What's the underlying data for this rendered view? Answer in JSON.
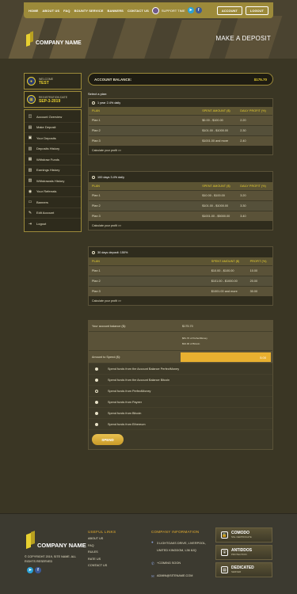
{
  "header": {
    "nav": [
      "HOME",
      "ABOUT US",
      "FAQ",
      "BOUNTY SERVICE",
      "BANNERS",
      "CONTACT US"
    ],
    "support_text": "SUPPORT TIME",
    "account_btn": "ACCOUNT",
    "logout_btn": "LOGOUT",
    "company": "COMPANY NAME",
    "page_title": "MAKE A DEPOSIT"
  },
  "sidebar": {
    "welcome_label": "WELCOME",
    "welcome_value": "TEST",
    "reg_label": "REGISTRATION DATE",
    "reg_value": "SEP-3-2019",
    "menu": [
      {
        "label": "Account Overview",
        "icon": "dashboard-icon"
      },
      {
        "label": "Make Deposit",
        "icon": "deposit-icon"
      },
      {
        "label": "Your Deposits",
        "icon": "folder-icon"
      },
      {
        "label": "Deposits History",
        "icon": "history-icon"
      },
      {
        "label": "Withdraw Funds",
        "icon": "withdraw-icon"
      },
      {
        "label": "Earnings History",
        "icon": "earnings-icon"
      },
      {
        "label": "Withdrawals History",
        "icon": "withdrawals-icon"
      },
      {
        "label": "Your Referrals",
        "icon": "referrals-icon"
      },
      {
        "label": "Banners",
        "icon": "banner-icon"
      },
      {
        "label": "Edit Account",
        "icon": "edit-icon"
      },
      {
        "label": "Logout",
        "icon": "logout-icon"
      }
    ]
  },
  "main": {
    "balance_label": "ACCOUNT BALANCE:",
    "balance_value": "$175.70",
    "select_plan": "Select a plan:",
    "plans": [
      {
        "title": "1 year 2.4% daily",
        "headers": [
          "PLAN",
          "SPENT AMOUNT ($)",
          "DAILY PROFIT (%)"
        ],
        "rows": [
          [
            "Plan 1",
            "$0.00 - $100.00",
            "2.20"
          ],
          [
            "Plan 2",
            "$101.00 - $1000.00",
            "2.30"
          ],
          [
            "Plan 3",
            "$1001.00 and more",
            "2.40"
          ]
        ],
        "calc": "Calculate your profit >>"
      },
      {
        "title": "100 days 3.4% daily",
        "headers": [
          "PLAN",
          "SPENT AMOUNT ($)",
          "DAILY PROFIT (%)"
        ],
        "rows": [
          [
            "Plan 1",
            "$10.00 - $100.00",
            "3.20"
          ],
          [
            "Plan 2",
            "$101.00 - $1000.00",
            "3.30"
          ],
          [
            "Plan 3",
            "$1001.00 - $5000.00",
            "3.40"
          ]
        ],
        "calc": "Calculate your profit >>"
      },
      {
        "title": "30 days deposit: 150%",
        "headers": [
          "PLAN",
          "SPENT AMOUNT ($)",
          "PROFIT (%)"
        ],
        "rows": [
          [
            "Plan 1",
            "$10.00 - $100.00",
            "10.00"
          ],
          [
            "Plan 2",
            "$101.00 - $1000.00",
            "20.00"
          ],
          [
            "Plan 3",
            "$1001.00 and more",
            "30.00"
          ]
        ],
        "calc": "Calculate your profit >>"
      }
    ],
    "spend": {
      "balance_label": "Your account balance ($):",
      "balance_value": "$175.70",
      "pm_note": "$81.70 of PerfectMoney",
      "btc_note": "$94.00 of Bitcoin",
      "amount_label": "Amount to Spend ($):",
      "amount_value": "5.00",
      "options": [
        "Spend funds from the Account Balance PerfectMoney",
        "Spend funds from the Account Balance Bitcoin",
        "Spend funds from PerfectMoney",
        "Spend funds from Payeer",
        "Spend funds from Bitcoin",
        "Spend funds from Ethereum"
      ],
      "button": "SPEND"
    }
  },
  "footer": {
    "company": "COMPANY NAME",
    "copyright_line1": "© COPYRIGHT 2019, SITE NAME. ALL",
    "copyright_line2": "RIGHTS RESERVED",
    "links_title": "USEFUL LINKS",
    "links": [
      "ABOUT US",
      "FAQ",
      "RULES",
      "RATE US",
      "CONTACT US"
    ],
    "info_title": "COMPANY INFORMATION",
    "address1": "3 LIGHTOAKS DRIVE, LIVERPOOL,",
    "address2": "UNITED KINGDOM, L36 8JQ",
    "phone": "+COMING SOON",
    "email": "ADMIN@SITENAME.COM",
    "badges": [
      {
        "title": "COMODO",
        "sub": "SSL CERTIFICATE"
      },
      {
        "title": "ANTIDDOS",
        "sub": "PROTECTION"
      },
      {
        "title": "DEDICATED",
        "sub": "SERVER"
      }
    ]
  }
}
